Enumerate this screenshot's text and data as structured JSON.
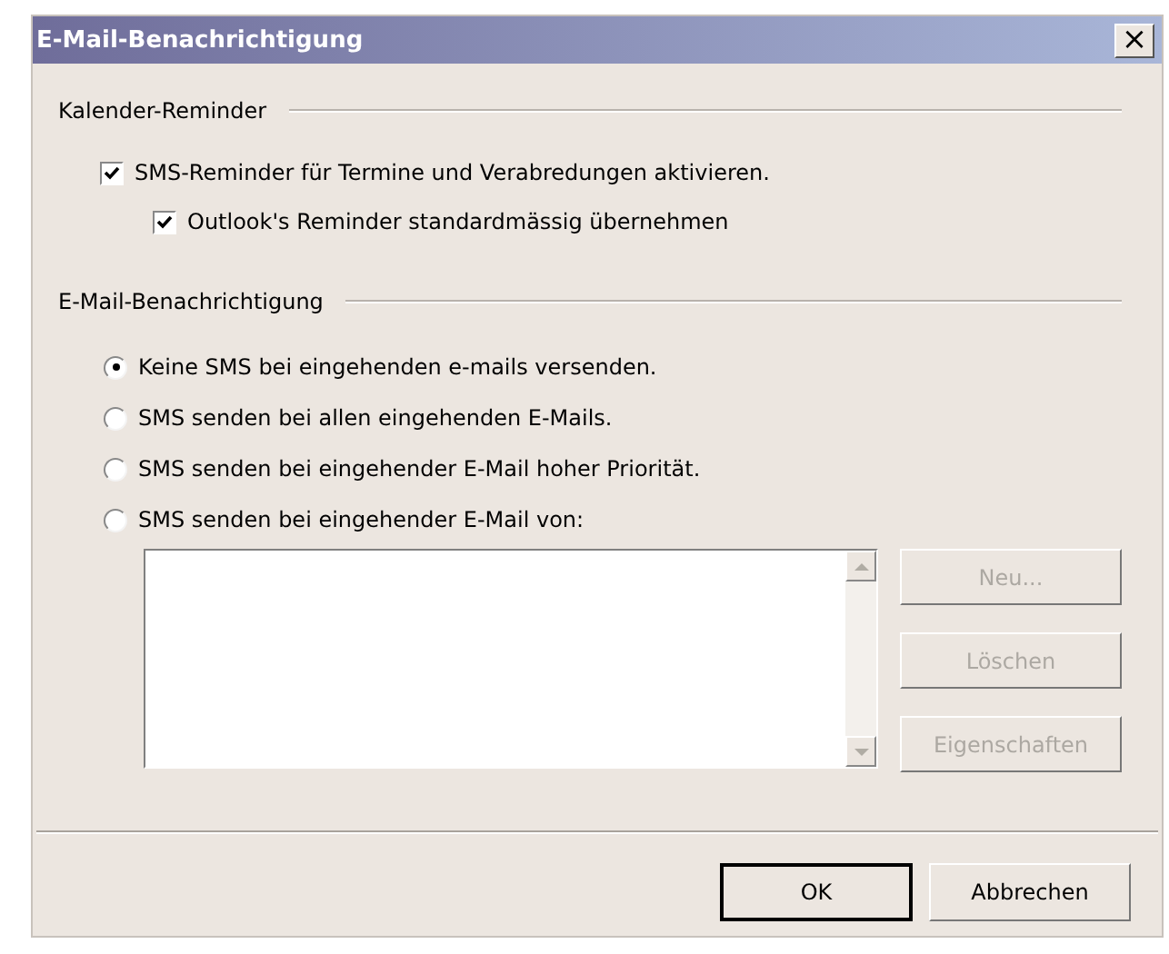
{
  "window": {
    "title": "E-Mail-Benachrichtigung",
    "close_glyph": "×"
  },
  "calendar": {
    "title": "Kalender-Reminder",
    "checkboxes": [
      {
        "label": "SMS-Reminder für Termine und Verabredungen aktivieren.",
        "checked": true,
        "children": [
          {
            "label": "Outlook's Reminder standardmässig übernehmen",
            "checked": true
          }
        ]
      }
    ]
  },
  "notification": {
    "title": "E-Mail-Benachrichtigung",
    "options": [
      {
        "label": "Keine SMS bei eingehenden e-mails versenden.",
        "selected": true
      },
      {
        "label": "SMS senden bei allen eingehenden E-Mails.",
        "selected": false
      },
      {
        "label": "SMS senden bei eingehender E-Mail hoher Priorität.",
        "selected": false
      },
      {
        "label": "SMS senden bei eingehender E-Mail von:",
        "selected": false
      }
    ],
    "side_buttons": [
      {
        "label": "Neu...",
        "disabled": true
      },
      {
        "label": "Löschen",
        "disabled": true
      },
      {
        "label": "Eigenschaften",
        "disabled": true
      }
    ]
  },
  "buttons": [
    {
      "label": "OK",
      "default": true
    },
    {
      "label": "Abbrechen",
      "default": false
    }
  ]
}
